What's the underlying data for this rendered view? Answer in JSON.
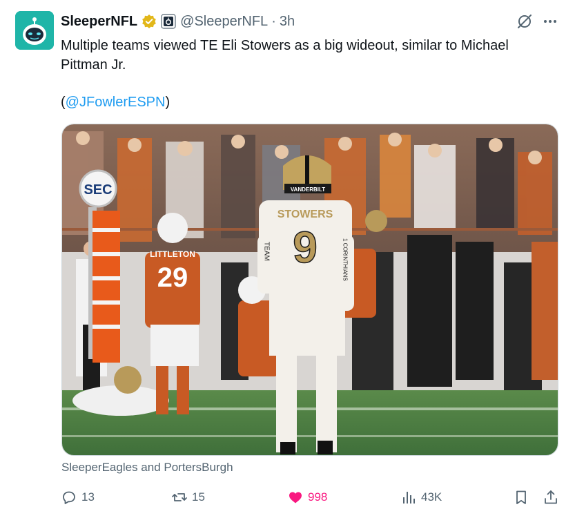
{
  "author": {
    "display_name": "SleeperNFL",
    "handle": "@SleeperNFL",
    "time": "3h",
    "avatar_icon": "sleeper-robot-logo",
    "verified_icon": "verified-gold-badge-icon",
    "affiliate_icon": "affiliate-badge-icon"
  },
  "tweet": {
    "text": "Multiple teams viewed TE Eli Stowers as a big wideout, similar to Michael Pittman Jr.",
    "mention_open": "(",
    "mention": "@JFowlerESPN",
    "mention_close": ")"
  },
  "media": {
    "alt": "Vanderbilt player #9 Stowers walking on the field",
    "jersey_name": "STOWERS",
    "jersey_number": "9",
    "helmet_text": "VANDERBILT",
    "opponent_name": "LITTLETON",
    "opponent_number": "29",
    "sign_text": "SEC",
    "sleeve_left": "TEAM",
    "sleeve_right": "1 CORINTHIANS"
  },
  "tagged": "SleeperEagles and PortersBurgh",
  "actions": {
    "reply_count": "13",
    "repost_count": "15",
    "like_count": "998",
    "views_count": "43K"
  },
  "colors": {
    "brand_blue": "#1d9bf0",
    "like_pink": "#f91880",
    "muted": "#536471",
    "avatar_teal": "#1fb5a8",
    "verified_gold": "#e2b719"
  }
}
